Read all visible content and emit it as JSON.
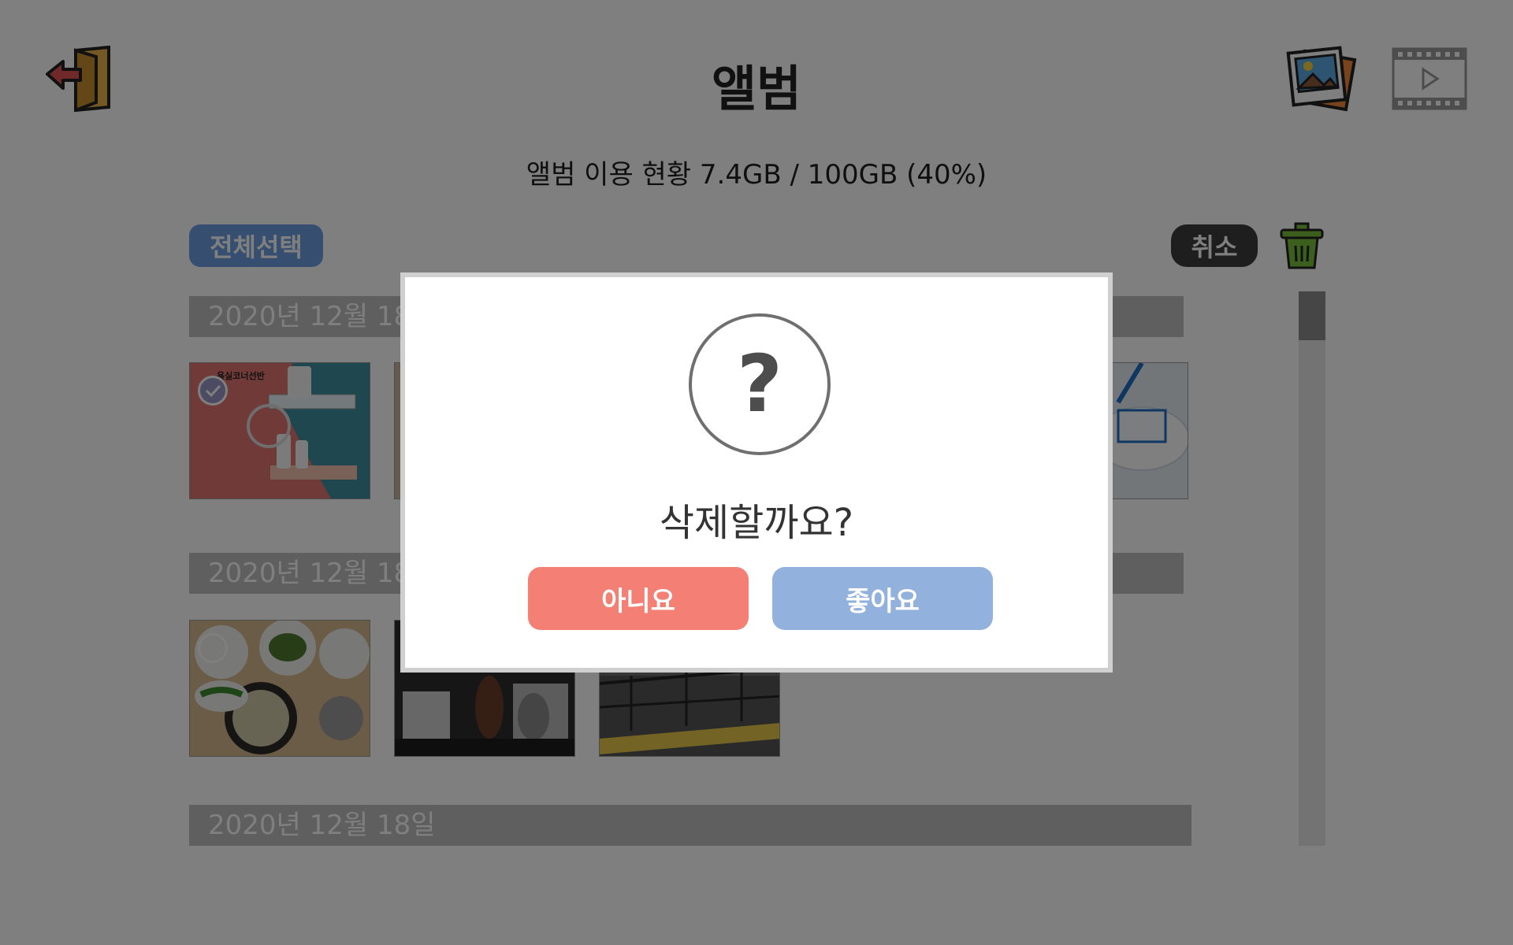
{
  "header": {
    "title": "앨범",
    "exit_icon": "exit-door-icon",
    "photo_tab_icon": "photo-album-icon",
    "video_tab_icon": "film-video-icon"
  },
  "usage": {
    "text": "앨범 이용 현황 7.4GB / 100GB (40%)"
  },
  "toolbar": {
    "select_all_label": "전체선택",
    "cancel_label": "취소",
    "delete_icon": "trash-can-icon"
  },
  "groups": [
    {
      "date": "2020년 12월 18일"
    },
    {
      "date": "2020년 12월 18일"
    },
    {
      "date": "2020년 12월 18일"
    }
  ],
  "thumbnail_text": {
    "shelf_caption": "욕실코너선반"
  },
  "dialog": {
    "icon": "question-mark-icon",
    "symbol": "?",
    "message": "삭제할까요?",
    "no_label": "아니요",
    "yes_label": "좋아요"
  },
  "colors": {
    "select_all": "#6c9fe0",
    "cancel": "#3c3c3c",
    "no_button": "#f47f74",
    "yes_button": "#92b1dc",
    "overlay": "rgba(0,0,0,0.5)"
  }
}
